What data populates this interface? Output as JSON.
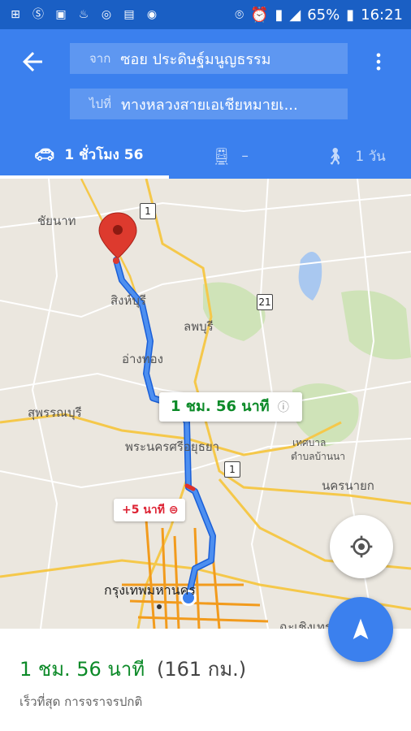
{
  "status_bar": {
    "icons": [
      "notification-icon",
      "s-icon",
      "image-icon",
      "fire-icon",
      "jr-icon",
      "app-icon",
      "camera-icon"
    ],
    "battery": "65%",
    "time": "16:21"
  },
  "header": {
    "from_prefix": "จาก",
    "from_value": "ซอย ประดิษฐ์มนูญธรรม",
    "to_prefix": "ไปที่",
    "to_value": "ทางหลวงสายเอเชียหมายเ..."
  },
  "tabs": [
    {
      "icon": "car-icon",
      "label": "1 ชั่วโมง 56"
    },
    {
      "icon": "train-icon",
      "label": "–"
    },
    {
      "icon": "walk-icon",
      "label": "1 วัน"
    }
  ],
  "map": {
    "labels": {
      "chainat": "ชัยนาท",
      "singburi": "สิงห์บุรี",
      "lopburi": "ลพบุรี",
      "angthong": "อ่างทอง",
      "suphanburi": "สุพรรณบุรี",
      "ayutthaya": "พระนครศรีอยุธยา",
      "thesaban": "เทศบาล",
      "tambon": "ตำบลบ้านนา",
      "nakhonnayok": "นครนายก",
      "bangkok": "กรุงเทพมหานคร",
      "chachoengsao": "ฉะเชิงเทรา"
    },
    "shields": [
      "1",
      "21",
      "1"
    ],
    "route_time": "1 ชม. 56 นาที",
    "delay": "+5 นาที"
  },
  "bottom": {
    "duration": "1 ชม. 56 นาที",
    "distance": "(161 กม.)",
    "description": "เร็วที่สุด การจราจรปกติ"
  }
}
